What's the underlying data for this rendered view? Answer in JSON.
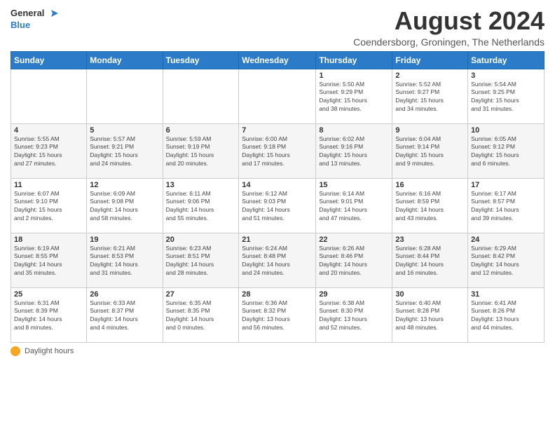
{
  "header": {
    "logo_line1": "General",
    "logo_line2": "Blue",
    "month_title": "August 2024",
    "subtitle": "Coendersborg, Groningen, The Netherlands"
  },
  "days_of_week": [
    "Sunday",
    "Monday",
    "Tuesday",
    "Wednesday",
    "Thursday",
    "Friday",
    "Saturday"
  ],
  "weeks": [
    [
      {
        "day": "",
        "info": ""
      },
      {
        "day": "",
        "info": ""
      },
      {
        "day": "",
        "info": ""
      },
      {
        "day": "",
        "info": ""
      },
      {
        "day": "1",
        "info": "Sunrise: 5:50 AM\nSunset: 9:29 PM\nDaylight: 15 hours\nand 38 minutes."
      },
      {
        "day": "2",
        "info": "Sunrise: 5:52 AM\nSunset: 9:27 PM\nDaylight: 15 hours\nand 34 minutes."
      },
      {
        "day": "3",
        "info": "Sunrise: 5:54 AM\nSunset: 9:25 PM\nDaylight: 15 hours\nand 31 minutes."
      }
    ],
    [
      {
        "day": "4",
        "info": "Sunrise: 5:55 AM\nSunset: 9:23 PM\nDaylight: 15 hours\nand 27 minutes."
      },
      {
        "day": "5",
        "info": "Sunrise: 5:57 AM\nSunset: 9:21 PM\nDaylight: 15 hours\nand 24 minutes."
      },
      {
        "day": "6",
        "info": "Sunrise: 5:59 AM\nSunset: 9:19 PM\nDaylight: 15 hours\nand 20 minutes."
      },
      {
        "day": "7",
        "info": "Sunrise: 6:00 AM\nSunset: 9:18 PM\nDaylight: 15 hours\nand 17 minutes."
      },
      {
        "day": "8",
        "info": "Sunrise: 6:02 AM\nSunset: 9:16 PM\nDaylight: 15 hours\nand 13 minutes."
      },
      {
        "day": "9",
        "info": "Sunrise: 6:04 AM\nSunset: 9:14 PM\nDaylight: 15 hours\nand 9 minutes."
      },
      {
        "day": "10",
        "info": "Sunrise: 6:05 AM\nSunset: 9:12 PM\nDaylight: 15 hours\nand 6 minutes."
      }
    ],
    [
      {
        "day": "11",
        "info": "Sunrise: 6:07 AM\nSunset: 9:10 PM\nDaylight: 15 hours\nand 2 minutes."
      },
      {
        "day": "12",
        "info": "Sunrise: 6:09 AM\nSunset: 9:08 PM\nDaylight: 14 hours\nand 58 minutes."
      },
      {
        "day": "13",
        "info": "Sunrise: 6:11 AM\nSunset: 9:06 PM\nDaylight: 14 hours\nand 55 minutes."
      },
      {
        "day": "14",
        "info": "Sunrise: 6:12 AM\nSunset: 9:03 PM\nDaylight: 14 hours\nand 51 minutes."
      },
      {
        "day": "15",
        "info": "Sunrise: 6:14 AM\nSunset: 9:01 PM\nDaylight: 14 hours\nand 47 minutes."
      },
      {
        "day": "16",
        "info": "Sunrise: 6:16 AM\nSunset: 8:59 PM\nDaylight: 14 hours\nand 43 minutes."
      },
      {
        "day": "17",
        "info": "Sunrise: 6:17 AM\nSunset: 8:57 PM\nDaylight: 14 hours\nand 39 minutes."
      }
    ],
    [
      {
        "day": "18",
        "info": "Sunrise: 6:19 AM\nSunset: 8:55 PM\nDaylight: 14 hours\nand 35 minutes."
      },
      {
        "day": "19",
        "info": "Sunrise: 6:21 AM\nSunset: 8:53 PM\nDaylight: 14 hours\nand 31 minutes."
      },
      {
        "day": "20",
        "info": "Sunrise: 6:23 AM\nSunset: 8:51 PM\nDaylight: 14 hours\nand 28 minutes."
      },
      {
        "day": "21",
        "info": "Sunrise: 6:24 AM\nSunset: 8:48 PM\nDaylight: 14 hours\nand 24 minutes."
      },
      {
        "day": "22",
        "info": "Sunrise: 6:26 AM\nSunset: 8:46 PM\nDaylight: 14 hours\nand 20 minutes."
      },
      {
        "day": "23",
        "info": "Sunrise: 6:28 AM\nSunset: 8:44 PM\nDaylight: 14 hours\nand 16 minutes."
      },
      {
        "day": "24",
        "info": "Sunrise: 6:29 AM\nSunset: 8:42 PM\nDaylight: 14 hours\nand 12 minutes."
      }
    ],
    [
      {
        "day": "25",
        "info": "Sunrise: 6:31 AM\nSunset: 8:39 PM\nDaylight: 14 hours\nand 8 minutes."
      },
      {
        "day": "26",
        "info": "Sunrise: 6:33 AM\nSunset: 8:37 PM\nDaylight: 14 hours\nand 4 minutes."
      },
      {
        "day": "27",
        "info": "Sunrise: 6:35 AM\nSunset: 8:35 PM\nDaylight: 14 hours\nand 0 minutes."
      },
      {
        "day": "28",
        "info": "Sunrise: 6:36 AM\nSunset: 8:32 PM\nDaylight: 13 hours\nand 56 minutes."
      },
      {
        "day": "29",
        "info": "Sunrise: 6:38 AM\nSunset: 8:30 PM\nDaylight: 13 hours\nand 52 minutes."
      },
      {
        "day": "30",
        "info": "Sunrise: 6:40 AM\nSunset: 8:28 PM\nDaylight: 13 hours\nand 48 minutes."
      },
      {
        "day": "31",
        "info": "Sunrise: 6:41 AM\nSunset: 8:26 PM\nDaylight: 13 hours\nand 44 minutes."
      }
    ]
  ],
  "footer": {
    "daylight_label": "Daylight hours"
  }
}
